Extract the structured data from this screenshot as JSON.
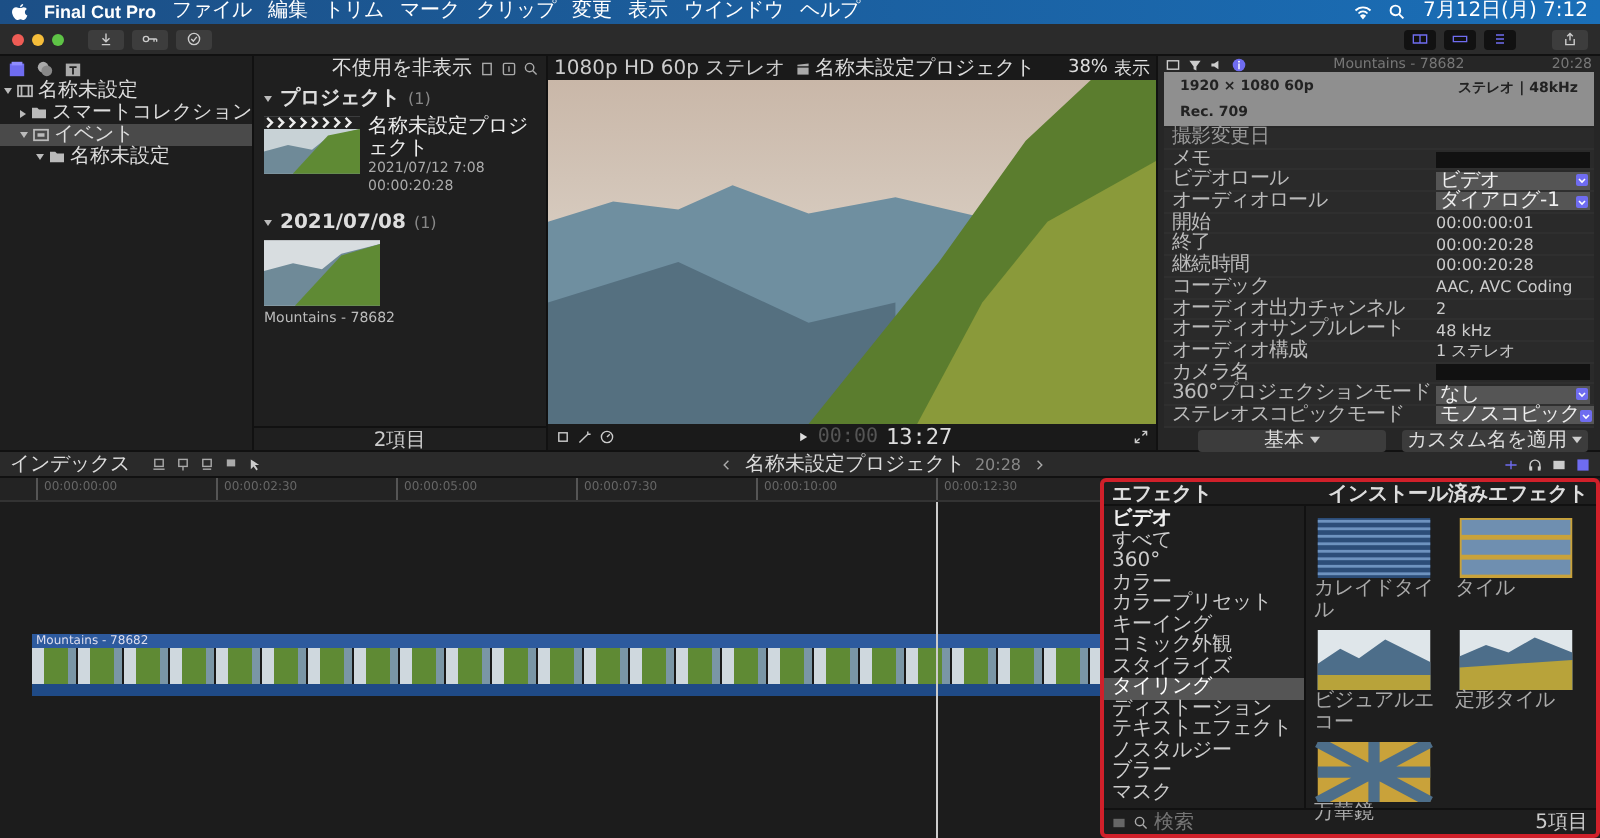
{
  "menu_bar": {
    "app": "Final Cut Pro",
    "items": [
      "ファイル",
      "編集",
      "トリム",
      "マーク",
      "クリップ",
      "変更",
      "表示",
      "ウインドウ",
      "ヘルプ"
    ],
    "clock": "7月12日(月) 7:12"
  },
  "sidebar": {
    "items": [
      {
        "label": "名称未設定",
        "kind": "library",
        "expanded": true,
        "selected": false,
        "children": [
          {
            "label": "スマートコレクション",
            "kind": "folder",
            "expanded": false,
            "selected": false
          },
          {
            "label": "イベント",
            "kind": "event",
            "expanded": true,
            "selected": true,
            "children": [
              {
                "label": "名称未設定",
                "kind": "folder",
                "expanded": true,
                "selected": false
              }
            ]
          }
        ]
      }
    ]
  },
  "browser": {
    "filter": "不使用を非表示",
    "sections": [
      {
        "title": "プロジェクト",
        "count": "(1)",
        "expanded": true,
        "items": [
          {
            "kind": "project",
            "name": "名称未設定プロジェクト",
            "date": "2021/07/12 7:08",
            "duration": "00:00:20:28"
          }
        ]
      },
      {
        "title": "2021/07/08",
        "count": "(1)",
        "expanded": true,
        "items": [
          {
            "kind": "clip",
            "name": "Mountains - 78682"
          }
        ]
      }
    ],
    "footer": "2項目"
  },
  "viewer": {
    "format": "1080p HD 60p ステレオ",
    "title": "名称未設定プロジェクト",
    "zoom": "38%",
    "view": "表示",
    "timecode_lead": "00:00",
    "timecode": "13:27"
  },
  "inspector": {
    "clip_name": "Mountains - 78682",
    "duration": "20:28",
    "video_format": "1920 × 1080 60p",
    "audio_format": "ステレオ | 48kHz",
    "color_space": "Rec. 709",
    "rows": [
      {
        "kind": "header",
        "label": "撮影変更日"
      },
      {
        "kind": "field",
        "label": "メモ"
      },
      {
        "kind": "popup",
        "label": "ビデオロール",
        "value": "ビデオ"
      },
      {
        "kind": "popup",
        "label": "オーディオロール",
        "value": "ダイアログ-1"
      },
      {
        "kind": "text",
        "label": "開始",
        "value": "00:00:00:01"
      },
      {
        "kind": "text",
        "label": "終了",
        "value": "00:00:20:28"
      },
      {
        "kind": "text",
        "label": "継続時間",
        "value": "00:00:20:28"
      },
      {
        "kind": "text",
        "label": "コーデック",
        "value": "AAC, AVC Coding"
      },
      {
        "kind": "text",
        "label": "オーディオ出力チャンネル",
        "value": "2"
      },
      {
        "kind": "text",
        "label": "オーディオサンプルレート",
        "value": "48 kHz"
      },
      {
        "kind": "text",
        "label": "オーディオ構成",
        "value": "1 ステレオ"
      },
      {
        "kind": "field",
        "label": "カメラ名"
      },
      {
        "kind": "popup",
        "label": "360°プロジェクションモード",
        "value": "なし"
      },
      {
        "kind": "popup",
        "label": "ステレオスコピックモード",
        "value": "モノスコピック"
      }
    ],
    "buttons": [
      "基本",
      "カスタム名を適用"
    ]
  },
  "timeline": {
    "index": "インデックス",
    "project": "名称未設定プロジェクト",
    "duration": "20:28",
    "ruler": [
      "00:00:00:00",
      "00:00:02:30",
      "00:00:05:00",
      "00:00:07:30",
      "00:00:10:00",
      "00:00:12:30"
    ],
    "clip": "Mountains - 78682"
  },
  "effects": {
    "title": "エフェクト",
    "source": "インストール済みエフェクト",
    "categories": [
      {
        "label": "ビデオ",
        "kind": "group",
        "selected": false
      },
      {
        "label": "すべて",
        "kind": "item",
        "selected": false
      },
      {
        "label": "360°",
        "kind": "item",
        "selected": false
      },
      {
        "label": "カラー",
        "kind": "item",
        "selected": false
      },
      {
        "label": "カラープリセット",
        "kind": "item",
        "selected": false
      },
      {
        "label": "キーイング",
        "kind": "item",
        "selected": false
      },
      {
        "label": "コミック外観",
        "kind": "item",
        "selected": false
      },
      {
        "label": "スタイライズ",
        "kind": "item",
        "selected": false
      },
      {
        "label": "タイリング",
        "kind": "item",
        "selected": true
      },
      {
        "label": "ディストーション",
        "kind": "item",
        "selected": false
      },
      {
        "label": "テキストエフェクト",
        "kind": "item",
        "selected": false
      },
      {
        "label": "ノスタルジー",
        "kind": "item",
        "selected": false
      },
      {
        "label": "ブラー",
        "kind": "item",
        "selected": false
      },
      {
        "label": "マスク",
        "kind": "item",
        "selected": false
      }
    ],
    "items": [
      {
        "name": "カレイドタイル",
        "kind": "stripes"
      },
      {
        "name": "タイル",
        "kind": "tiles"
      },
      {
        "name": "ビジュアルエコー",
        "kind": "landscape"
      },
      {
        "name": "定形タイル",
        "kind": "split"
      },
      {
        "name": "万華鏡",
        "kind": "kaleido"
      }
    ],
    "search": {
      "placeholder": "検索"
    },
    "count": "5項目"
  }
}
